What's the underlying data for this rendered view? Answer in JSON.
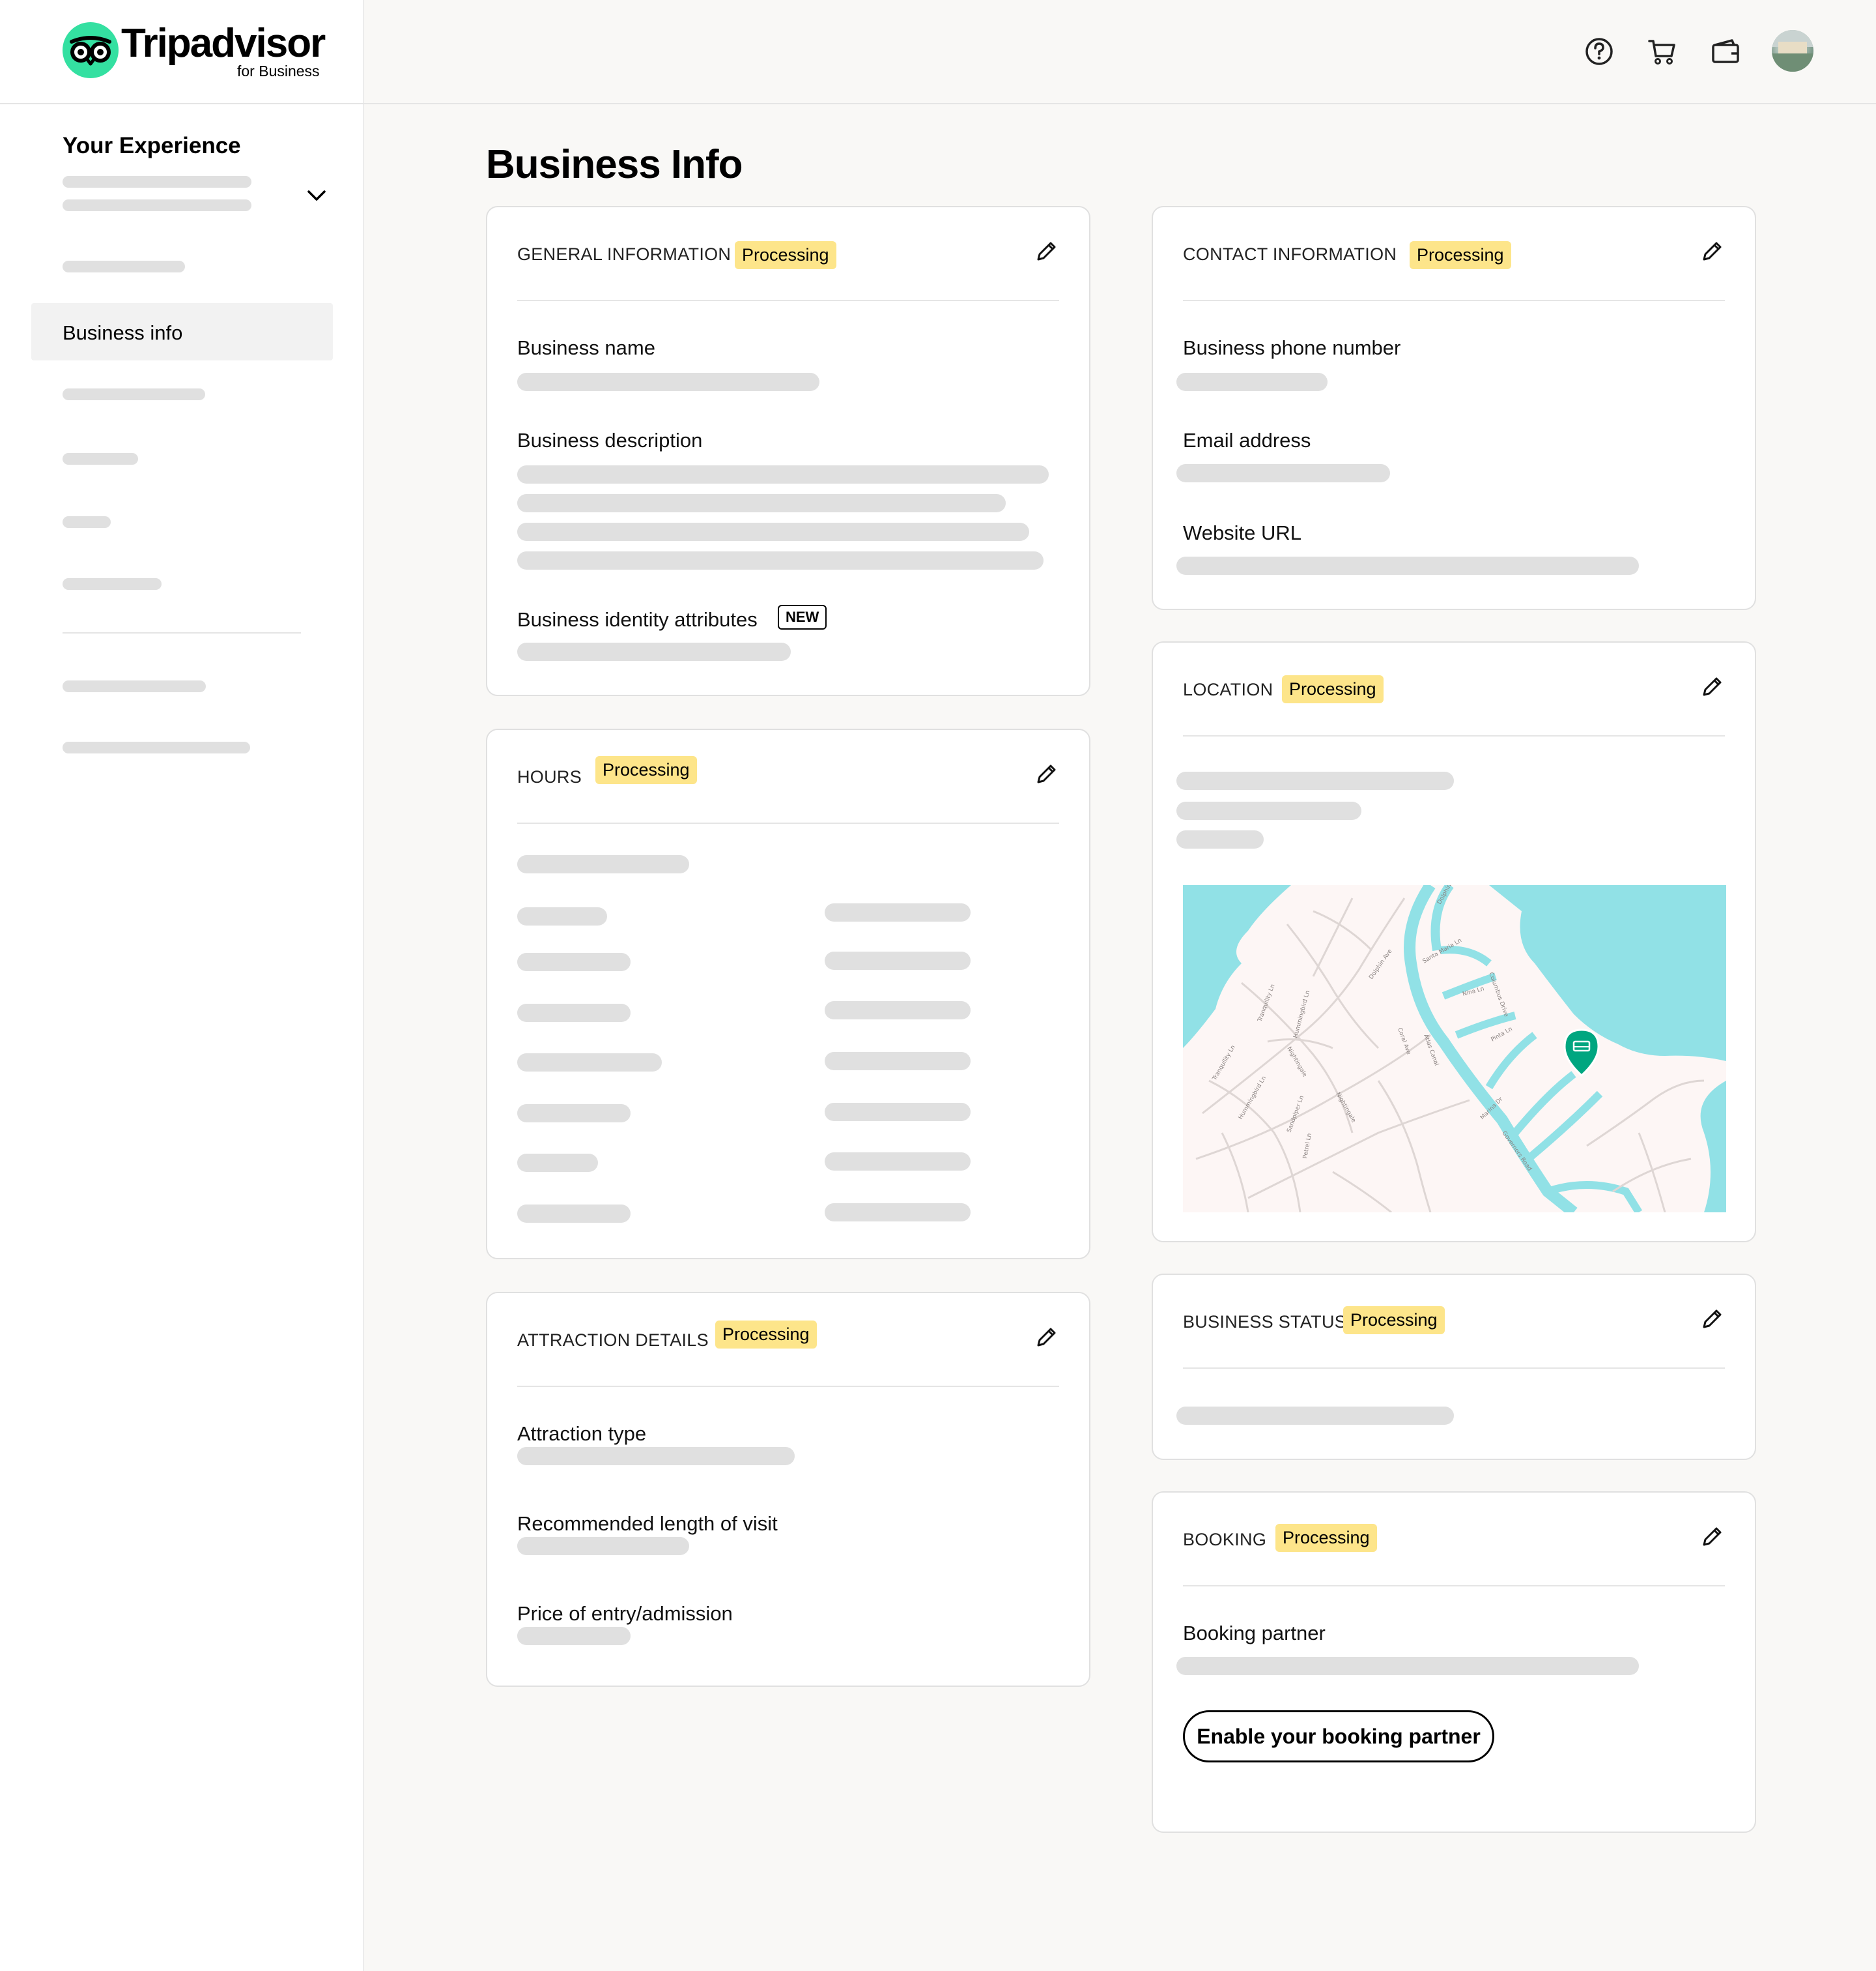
{
  "header": {
    "brand": "Tripadvisor",
    "brand_sub": "for Business",
    "icons": [
      "help-icon",
      "cart-icon",
      "wallet-icon",
      "avatar"
    ]
  },
  "sidebar": {
    "title": "Your Experience",
    "active_item": "Business info"
  },
  "page_title": "Business Info",
  "status_label": "Processing",
  "colors": {
    "brand_green": "#34e0a1",
    "badge_yellow": "#fde58a",
    "map_water": "#91e1e6",
    "map_land": "#fdf6f5",
    "pin_green": "#00a680"
  },
  "general_information": {
    "heading": "GENERAL INFORMATION",
    "fields": {
      "business_name": "Business name",
      "business_description": "Business description",
      "business_identity_attributes": "Business identity attributes"
    },
    "new_badge": "NEW"
  },
  "hours": {
    "heading": "HOURS"
  },
  "attraction_details": {
    "heading": "ATTRACTION DETAILS",
    "fields": {
      "attraction_type": "Attraction type",
      "recommended_length": "Recommended length of visit",
      "price": "Price of entry/admission"
    }
  },
  "contact_information": {
    "heading": "CONTACT INFORMATION",
    "fields": {
      "phone": "Business phone number",
      "email": "Email address",
      "website": "Website URL"
    }
  },
  "location": {
    "heading": "LOCATION"
  },
  "business_status": {
    "heading": "BUSINESS STATUS"
  },
  "booking": {
    "heading": "BOOKING",
    "fields": {
      "partner": "Booking partner"
    },
    "button": "Enable your booking partner"
  }
}
